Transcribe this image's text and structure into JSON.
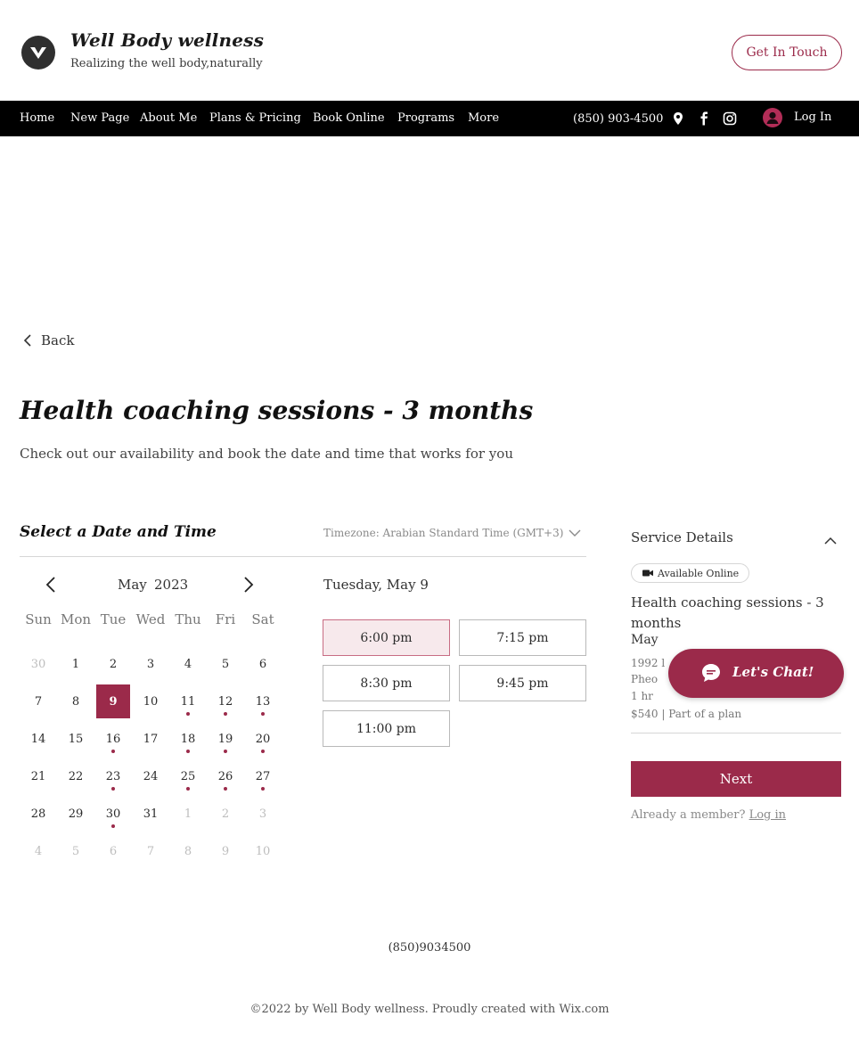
{
  "header": {
    "brand_title": "Well Body wellness",
    "brand_tagline": "Realizing the well body,naturally",
    "cta_label": "Get In Touch",
    "logo_icon": "v-logo-icon"
  },
  "nav": {
    "items": [
      {
        "label": "Home"
      },
      {
        "label": "New Page"
      },
      {
        "label": "About Me"
      },
      {
        "label": "Plans & Pricing"
      },
      {
        "label": "Book Online"
      },
      {
        "label": "Programs"
      },
      {
        "label": "More"
      }
    ],
    "phone": "(850) 903-4500",
    "icons": [
      "map-pin-icon",
      "facebook-icon",
      "instagram-icon"
    ],
    "login_label": "Log In"
  },
  "booking": {
    "back_label": "Back",
    "title": "Health coaching sessions - 3 months",
    "subtitle": "Check out our availability and book the date and time that works for you",
    "section_title": "Select a Date and Time",
    "timezone": "Timezone: Arabian Standard Time (GMT+3)"
  },
  "calendar": {
    "month": "May",
    "year": "2023",
    "weekdays": [
      "Sun",
      "Mon",
      "Tue",
      "Wed",
      "Thu",
      "Fri",
      "Sat"
    ],
    "weeks": [
      [
        {
          "d": "30",
          "muted": true
        },
        {
          "d": "1"
        },
        {
          "d": "2"
        },
        {
          "d": "3"
        },
        {
          "d": "4"
        },
        {
          "d": "5"
        },
        {
          "d": "6"
        }
      ],
      [
        {
          "d": "7"
        },
        {
          "d": "8"
        },
        {
          "d": "9",
          "selected": true
        },
        {
          "d": "10"
        },
        {
          "d": "11",
          "dot": true
        },
        {
          "d": "12",
          "dot": true
        },
        {
          "d": "13",
          "dot": true
        }
      ],
      [
        {
          "d": "14"
        },
        {
          "d": "15"
        },
        {
          "d": "16",
          "dot": true
        },
        {
          "d": "17"
        },
        {
          "d": "18",
          "dot": true
        },
        {
          "d": "19",
          "dot": true
        },
        {
          "d": "20",
          "dot": true
        }
      ],
      [
        {
          "d": "21"
        },
        {
          "d": "22"
        },
        {
          "d": "23",
          "dot": true
        },
        {
          "d": "24"
        },
        {
          "d": "25",
          "dot": true
        },
        {
          "d": "26",
          "dot": true
        },
        {
          "d": "27",
          "dot": true
        }
      ],
      [
        {
          "d": "28"
        },
        {
          "d": "29"
        },
        {
          "d": "30",
          "dot": true
        },
        {
          "d": "31"
        },
        {
          "d": "1",
          "muted": true
        },
        {
          "d": "2",
          "muted": true
        },
        {
          "d": "3",
          "muted": true
        }
      ],
      [
        {
          "d": "4",
          "muted": true
        },
        {
          "d": "5",
          "muted": true
        },
        {
          "d": "6",
          "muted": true
        },
        {
          "d": "7",
          "muted": true
        },
        {
          "d": "8",
          "muted": true
        },
        {
          "d": "9",
          "muted": true
        },
        {
          "d": "10",
          "muted": true
        }
      ]
    ],
    "accent_color": "#9b2a4a"
  },
  "slots": {
    "date_label": "Tuesday, May 9",
    "times": [
      "6:00 pm",
      "7:15 pm",
      "8:30 pm",
      "9:45 pm",
      "11:00 pm"
    ],
    "selected_index": 0
  },
  "service": {
    "title": "Service Details",
    "badge": "Available Online",
    "name": "Health coaching sessions - 3 months",
    "datetime": "May",
    "line_address": "1992 l",
    "line_location": "Pheo",
    "line_duration": "1 hr",
    "line_price": "$540 | Part of a plan",
    "next_label": "Next",
    "member_prompt": "Already a member?",
    "member_login": "Log in"
  },
  "chat": {
    "label": "Let's Chat!"
  },
  "footer": {
    "phone": "(850)9034500",
    "copyright": "©2022 by Well Body wellness. Proudly created with Wix.com"
  }
}
